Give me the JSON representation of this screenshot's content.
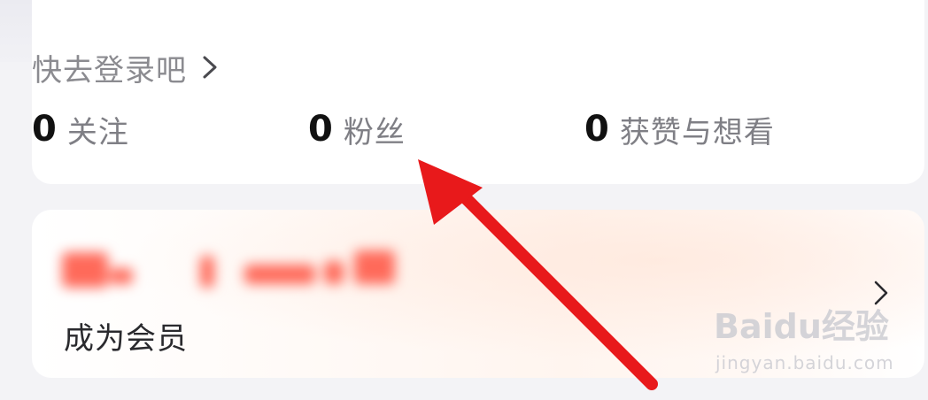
{
  "login": {
    "prompt": "快去登录吧",
    "chevron_icon": "chevron-right-icon"
  },
  "stats": [
    {
      "count": "0",
      "label": "关注"
    },
    {
      "count": "0",
      "label": "粉丝"
    },
    {
      "count": "0",
      "label": "获赞与想看"
    }
  ],
  "membership": {
    "label": "成为会员",
    "chevron_icon": "chevron-right-icon"
  },
  "watermark": {
    "brand": "Baidu经验",
    "url": "jingyan.baidu.com"
  },
  "colors": {
    "arrow": "#e8191b",
    "stat_number": "#111111",
    "muted_text": "#8b8b90",
    "card_bg": "#ffffff",
    "page_bg": "#f3f3f6"
  }
}
